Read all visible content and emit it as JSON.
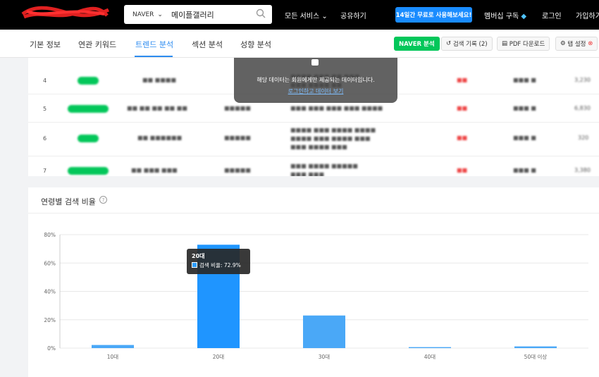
{
  "header": {
    "search_engine": "NAVER",
    "search_query": "메이플갤러리",
    "nav": [
      "모든 서비스",
      "공유하기"
    ],
    "trial_button": "14일간 무료로 사용해보세요!",
    "membership": "멤버십 구독",
    "login": "로그인",
    "signup": "가입하기"
  },
  "tabs": {
    "items": [
      "기본 정보",
      "연관 키워드",
      "트렌드 분석",
      "섹션 분석",
      "성향 분석"
    ],
    "active": "트렌드 분석"
  },
  "toolbar": {
    "naver_analysis": "NAVER 분석",
    "search_history": "검색 기록 (2)",
    "pdf_download": "PDF 다운로드",
    "tab_settings": "탭 설정"
  },
  "lock_overlay": {
    "message": "해당 데이터는 회원에게만 제공되는 데이터입니다.",
    "link": "로그인하고 데이터 보기"
  },
  "table": {
    "rows": [
      {
        "rank": "4"
      },
      {
        "rank": "5"
      },
      {
        "rank": "6"
      },
      {
        "rank": "7"
      }
    ]
  },
  "chart_section": {
    "title": "연령별 검색 비율",
    "tooltip": {
      "title": "20대",
      "label": "검색 비율",
      "value": "72.9%"
    }
  },
  "chart_data": {
    "type": "bar",
    "categories": [
      "10대",
      "20대",
      "30대",
      "40대",
      "50대 이상"
    ],
    "series": [
      {
        "name": "검색 비율",
        "values": [
          2.2,
          72.9,
          23.0,
          0.7,
          1.2
        ]
      }
    ],
    "ylim": [
      0,
      80
    ],
    "yticks": [
      "0%",
      "20%",
      "40%",
      "60%",
      "80%"
    ],
    "highlighted": "20대",
    "colors": {
      "bar": "#4aa8f7",
      "highlight": "#1f95ff",
      "grid": "#e8e8e8"
    }
  }
}
